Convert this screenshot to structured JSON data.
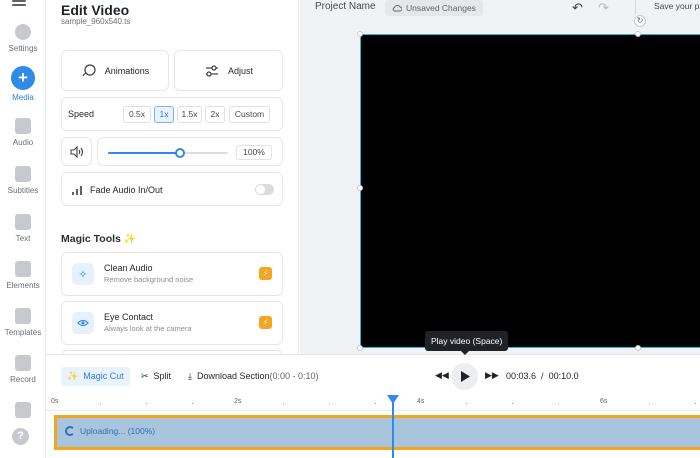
{
  "nav": {
    "items": [
      {
        "label": "Settings",
        "icon": "gear-icon"
      },
      {
        "label": "Media",
        "icon": "plus-icon",
        "active": true
      },
      {
        "label": "Audio",
        "icon": "music-note-icon"
      },
      {
        "label": "Subtitles",
        "icon": "subtitles-icon"
      },
      {
        "label": "Text",
        "icon": "text-icon"
      },
      {
        "label": "Elements",
        "icon": "shapes-icon"
      },
      {
        "label": "Templates",
        "icon": "templates-icon"
      },
      {
        "label": "Record",
        "icon": "record-icon"
      }
    ],
    "help": "?"
  },
  "panel": {
    "title": "Edit Video",
    "filename": "sample_960x540.ts",
    "animations_label": "Animations",
    "adjust_label": "Adjust",
    "speed": {
      "label": "Speed",
      "options": [
        "0.5x",
        "1x",
        "1.5x",
        "2x",
        "Custom"
      ],
      "selected": "1x"
    },
    "volume": {
      "value": "100%",
      "level": 0.6
    },
    "fade_label": "Fade Audio In/Out",
    "fade_enabled": false,
    "magic_title": "Magic Tools",
    "tools": [
      {
        "name": "Clean Audio",
        "desc": "Remove background noise",
        "icon": "sparkle-icon"
      },
      {
        "name": "Eye Contact",
        "desc": "Always look at the camera",
        "icon": "eye-icon"
      }
    ]
  },
  "header": {
    "project_label": "Project Name",
    "status": "Unsaved Changes",
    "save_label": "Save your p"
  },
  "timeline": {
    "magic_cut": "Magic Cut",
    "split": "Split",
    "download_label": "Download Section",
    "download_range": "(0:00 - 0:10)",
    "tooltip": "Play video (Space)",
    "current_time": "00:03.6",
    "separator": "/",
    "total_time": "00:10.0",
    "ticks": [
      "0s",
      "2s",
      "4s",
      "6s"
    ],
    "clip_label": "Uploading... (100%)",
    "playhead_seconds": 3.7
  },
  "colors": {
    "accent": "#2f8ae8",
    "clip_border": "#f2a51f",
    "clip_fill": "#a9c4dd",
    "video_bg": "#000000"
  }
}
